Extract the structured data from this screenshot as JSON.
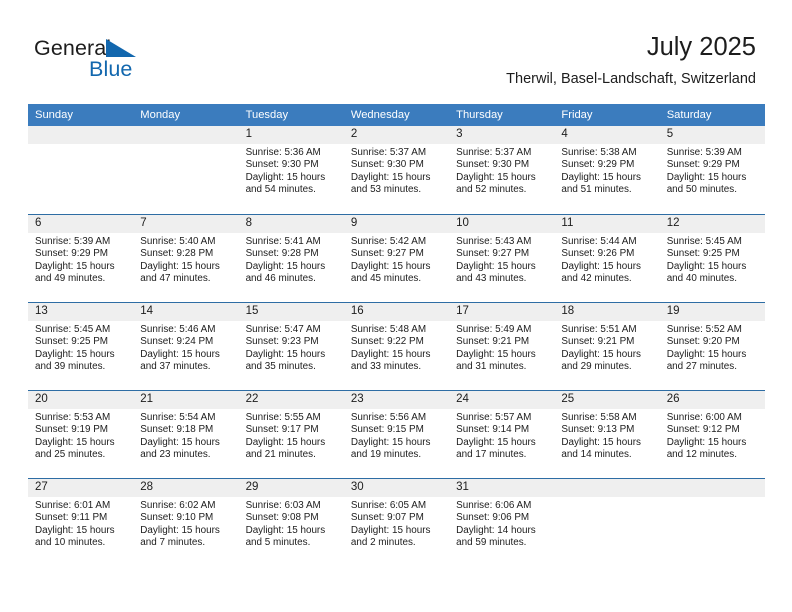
{
  "brand": {
    "name_top": "General",
    "name_bottom": "Blue",
    "logo_color": "#1267ae"
  },
  "header": {
    "title": "July 2025",
    "subtitle": "Therwil, Basel-Landschaft, Switzerland"
  },
  "theme": {
    "header_blue": "#3b7cbe",
    "row_divider": "#2e6da4",
    "daynum_band": "#efefef",
    "text": "#1d1d1d"
  },
  "weekdays": [
    "Sunday",
    "Monday",
    "Tuesday",
    "Wednesday",
    "Thursday",
    "Friday",
    "Saturday"
  ],
  "weeks": [
    [
      {
        "day": "",
        "sunrise": "",
        "sunset": "",
        "daylight1": "",
        "daylight2": ""
      },
      {
        "day": "",
        "sunrise": "",
        "sunset": "",
        "daylight1": "",
        "daylight2": ""
      },
      {
        "day": "1",
        "sunrise": "Sunrise: 5:36 AM",
        "sunset": "Sunset: 9:30 PM",
        "daylight1": "Daylight: 15 hours",
        "daylight2": "and 54 minutes."
      },
      {
        "day": "2",
        "sunrise": "Sunrise: 5:37 AM",
        "sunset": "Sunset: 9:30 PM",
        "daylight1": "Daylight: 15 hours",
        "daylight2": "and 53 minutes."
      },
      {
        "day": "3",
        "sunrise": "Sunrise: 5:37 AM",
        "sunset": "Sunset: 9:30 PM",
        "daylight1": "Daylight: 15 hours",
        "daylight2": "and 52 minutes."
      },
      {
        "day": "4",
        "sunrise": "Sunrise: 5:38 AM",
        "sunset": "Sunset: 9:29 PM",
        "daylight1": "Daylight: 15 hours",
        "daylight2": "and 51 minutes."
      },
      {
        "day": "5",
        "sunrise": "Sunrise: 5:39 AM",
        "sunset": "Sunset: 9:29 PM",
        "daylight1": "Daylight: 15 hours",
        "daylight2": "and 50 minutes."
      }
    ],
    [
      {
        "day": "6",
        "sunrise": "Sunrise: 5:39 AM",
        "sunset": "Sunset: 9:29 PM",
        "daylight1": "Daylight: 15 hours",
        "daylight2": "and 49 minutes."
      },
      {
        "day": "7",
        "sunrise": "Sunrise: 5:40 AM",
        "sunset": "Sunset: 9:28 PM",
        "daylight1": "Daylight: 15 hours",
        "daylight2": "and 47 minutes."
      },
      {
        "day": "8",
        "sunrise": "Sunrise: 5:41 AM",
        "sunset": "Sunset: 9:28 PM",
        "daylight1": "Daylight: 15 hours",
        "daylight2": "and 46 minutes."
      },
      {
        "day": "9",
        "sunrise": "Sunrise: 5:42 AM",
        "sunset": "Sunset: 9:27 PM",
        "daylight1": "Daylight: 15 hours",
        "daylight2": "and 45 minutes."
      },
      {
        "day": "10",
        "sunrise": "Sunrise: 5:43 AM",
        "sunset": "Sunset: 9:27 PM",
        "daylight1": "Daylight: 15 hours",
        "daylight2": "and 43 minutes."
      },
      {
        "day": "11",
        "sunrise": "Sunrise: 5:44 AM",
        "sunset": "Sunset: 9:26 PM",
        "daylight1": "Daylight: 15 hours",
        "daylight2": "and 42 minutes."
      },
      {
        "day": "12",
        "sunrise": "Sunrise: 5:45 AM",
        "sunset": "Sunset: 9:25 PM",
        "daylight1": "Daylight: 15 hours",
        "daylight2": "and 40 minutes."
      }
    ],
    [
      {
        "day": "13",
        "sunrise": "Sunrise: 5:45 AM",
        "sunset": "Sunset: 9:25 PM",
        "daylight1": "Daylight: 15 hours",
        "daylight2": "and 39 minutes."
      },
      {
        "day": "14",
        "sunrise": "Sunrise: 5:46 AM",
        "sunset": "Sunset: 9:24 PM",
        "daylight1": "Daylight: 15 hours",
        "daylight2": "and 37 minutes."
      },
      {
        "day": "15",
        "sunrise": "Sunrise: 5:47 AM",
        "sunset": "Sunset: 9:23 PM",
        "daylight1": "Daylight: 15 hours",
        "daylight2": "and 35 minutes."
      },
      {
        "day": "16",
        "sunrise": "Sunrise: 5:48 AM",
        "sunset": "Sunset: 9:22 PM",
        "daylight1": "Daylight: 15 hours",
        "daylight2": "and 33 minutes."
      },
      {
        "day": "17",
        "sunrise": "Sunrise: 5:49 AM",
        "sunset": "Sunset: 9:21 PM",
        "daylight1": "Daylight: 15 hours",
        "daylight2": "and 31 minutes."
      },
      {
        "day": "18",
        "sunrise": "Sunrise: 5:51 AM",
        "sunset": "Sunset: 9:21 PM",
        "daylight1": "Daylight: 15 hours",
        "daylight2": "and 29 minutes."
      },
      {
        "day": "19",
        "sunrise": "Sunrise: 5:52 AM",
        "sunset": "Sunset: 9:20 PM",
        "daylight1": "Daylight: 15 hours",
        "daylight2": "and 27 minutes."
      }
    ],
    [
      {
        "day": "20",
        "sunrise": "Sunrise: 5:53 AM",
        "sunset": "Sunset: 9:19 PM",
        "daylight1": "Daylight: 15 hours",
        "daylight2": "and 25 minutes."
      },
      {
        "day": "21",
        "sunrise": "Sunrise: 5:54 AM",
        "sunset": "Sunset: 9:18 PM",
        "daylight1": "Daylight: 15 hours",
        "daylight2": "and 23 minutes."
      },
      {
        "day": "22",
        "sunrise": "Sunrise: 5:55 AM",
        "sunset": "Sunset: 9:17 PM",
        "daylight1": "Daylight: 15 hours",
        "daylight2": "and 21 minutes."
      },
      {
        "day": "23",
        "sunrise": "Sunrise: 5:56 AM",
        "sunset": "Sunset: 9:15 PM",
        "daylight1": "Daylight: 15 hours",
        "daylight2": "and 19 minutes."
      },
      {
        "day": "24",
        "sunrise": "Sunrise: 5:57 AM",
        "sunset": "Sunset: 9:14 PM",
        "daylight1": "Daylight: 15 hours",
        "daylight2": "and 17 minutes."
      },
      {
        "day": "25",
        "sunrise": "Sunrise: 5:58 AM",
        "sunset": "Sunset: 9:13 PM",
        "daylight1": "Daylight: 15 hours",
        "daylight2": "and 14 minutes."
      },
      {
        "day": "26",
        "sunrise": "Sunrise: 6:00 AM",
        "sunset": "Sunset: 9:12 PM",
        "daylight1": "Daylight: 15 hours",
        "daylight2": "and 12 minutes."
      }
    ],
    [
      {
        "day": "27",
        "sunrise": "Sunrise: 6:01 AM",
        "sunset": "Sunset: 9:11 PM",
        "daylight1": "Daylight: 15 hours",
        "daylight2": "and 10 minutes."
      },
      {
        "day": "28",
        "sunrise": "Sunrise: 6:02 AM",
        "sunset": "Sunset: 9:10 PM",
        "daylight1": "Daylight: 15 hours",
        "daylight2": "and 7 minutes."
      },
      {
        "day": "29",
        "sunrise": "Sunrise: 6:03 AM",
        "sunset": "Sunset: 9:08 PM",
        "daylight1": "Daylight: 15 hours",
        "daylight2": "and 5 minutes."
      },
      {
        "day": "30",
        "sunrise": "Sunrise: 6:05 AM",
        "sunset": "Sunset: 9:07 PM",
        "daylight1": "Daylight: 15 hours",
        "daylight2": "and 2 minutes."
      },
      {
        "day": "31",
        "sunrise": "Sunrise: 6:06 AM",
        "sunset": "Sunset: 9:06 PM",
        "daylight1": "Daylight: 14 hours",
        "daylight2": "and 59 minutes."
      },
      {
        "day": "",
        "sunrise": "",
        "sunset": "",
        "daylight1": "",
        "daylight2": ""
      },
      {
        "day": "",
        "sunrise": "",
        "sunset": "",
        "daylight1": "",
        "daylight2": ""
      }
    ]
  ]
}
